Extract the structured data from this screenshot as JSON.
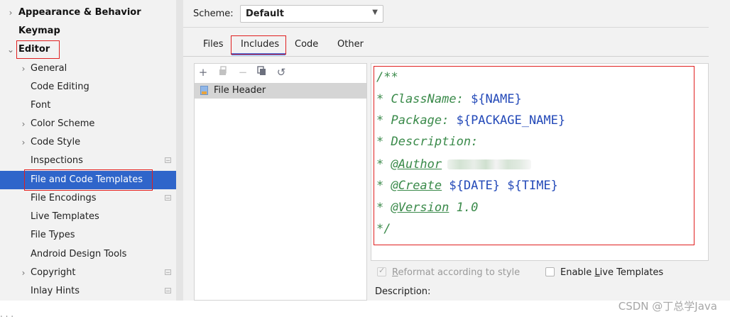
{
  "sidebar": {
    "items": [
      {
        "label": "Appearance & Behavior",
        "bold": true,
        "chevron": "›",
        "level": 0
      },
      {
        "label": "Keymap",
        "bold": true,
        "chevron": "",
        "level": 0
      },
      {
        "label": "Editor",
        "bold": true,
        "chevron": "⌄",
        "level": 0,
        "highlighted": true
      },
      {
        "label": "General",
        "chevron": "›",
        "level": 1
      },
      {
        "label": "Code Editing",
        "chevron": "",
        "level": 1
      },
      {
        "label": "Font",
        "chevron": "",
        "level": 1
      },
      {
        "label": "Color Scheme",
        "chevron": "›",
        "level": 1
      },
      {
        "label": "Code Style",
        "chevron": "›",
        "level": 1
      },
      {
        "label": "Inspections",
        "chevron": "",
        "level": 1,
        "project_icon": true
      },
      {
        "label": "File and Code Templates",
        "chevron": "",
        "level": 1,
        "selected": true,
        "highlighted": true
      },
      {
        "label": "File Encodings",
        "chevron": "",
        "level": 1,
        "project_icon": true
      },
      {
        "label": "Live Templates",
        "chevron": "",
        "level": 1
      },
      {
        "label": "File Types",
        "chevron": "",
        "level": 1
      },
      {
        "label": "Android Design Tools",
        "chevron": "",
        "level": 1
      },
      {
        "label": "Copyright",
        "chevron": "›",
        "level": 1,
        "project_icon": true
      },
      {
        "label": "Inlay Hints",
        "chevron": "",
        "level": 1,
        "project_icon": true
      }
    ]
  },
  "scheme": {
    "label": "Scheme:",
    "value": "Default"
  },
  "tabs": [
    {
      "label": "Files"
    },
    {
      "label": "Includes",
      "active": true
    },
    {
      "label": "Code"
    },
    {
      "label": "Other"
    }
  ],
  "toolbar": {
    "add": "+",
    "copy_icon": "copy-icon",
    "remove": "−",
    "duplicate_icon": "duplicate-icon",
    "reset": "↺"
  },
  "templates": [
    {
      "label": "File Header",
      "icon": "file-header-icon"
    }
  ],
  "editor": {
    "lines": [
      {
        "com": "/**"
      },
      {
        "com": "* ClassName: ",
        "var": "${NAME}"
      },
      {
        "com": "* Package: ",
        "var": "${PACKAGE_NAME}"
      },
      {
        "com": "* Description:"
      },
      {
        "pre": "* ",
        "tag": "@Author",
        "blurred": true
      },
      {
        "pre": "* ",
        "tag": "@Create",
        "var": " ${DATE} ${TIME}"
      },
      {
        "pre": "* ",
        "tag": "@Version",
        "com": " 1.0"
      },
      {
        "com": "*/"
      }
    ]
  },
  "options": {
    "reformat": {
      "label": "Reformat according to style",
      "mnemonic": "R",
      "checked": true,
      "enabled": false
    },
    "live_templates": {
      "label": "Enable Live Templates",
      "mnemonic": "L",
      "checked": false,
      "enabled": true
    }
  },
  "description_label": "Description:",
  "watermark": "CSDN @丁总学Java",
  "dots": ". . .",
  "colors": {
    "accent": "#3574f0",
    "selection": "#2f65ca",
    "annotation": "#e02020",
    "comment": "#3a8a4a",
    "variable": "#2349b8"
  }
}
